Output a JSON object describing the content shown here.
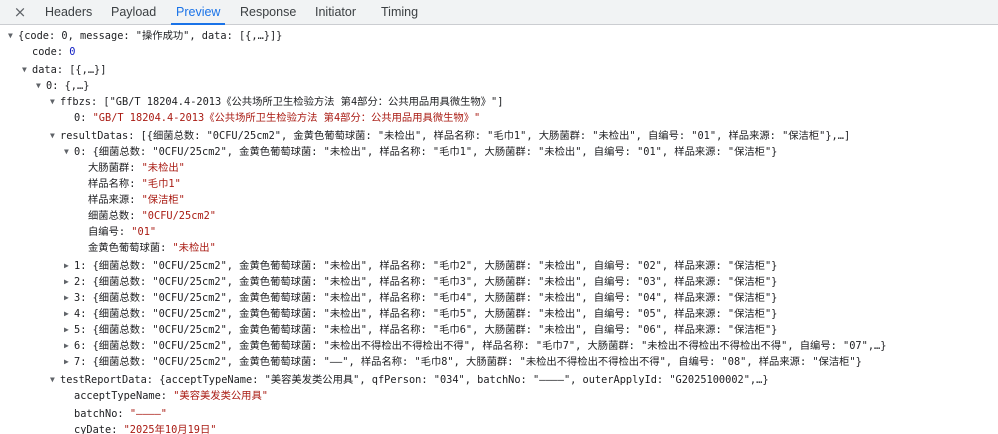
{
  "tabs": [
    {
      "label": "Headers",
      "active": false
    },
    {
      "label": "Payload",
      "active": false
    },
    {
      "label": "Preview",
      "active": true
    },
    {
      "label": "Response",
      "active": false
    },
    {
      "label": "Initiator",
      "active": false
    },
    {
      "label": "Timing",
      "active": false
    }
  ],
  "close_icon": "×",
  "tree": [
    {
      "toggle": "▼",
      "summary": "{code: 0, message: \"操作成功\", data: [{,…}]}"
    },
    {
      "key": "code",
      "value": "0",
      "vtype": "number"
    },
    {
      "toggle": "▼",
      "key": "data",
      "summary": "[{,…}]"
    },
    {
      "toggle": "▼",
      "key": "0",
      "summary": "{,…}"
    },
    {
      "toggle": "▼",
      "key": "ffbzs",
      "summary": "[\"GB/T 18204.4-2013《公共场所卫生检验方法 第4部分：公共用品用具微生物》\"]"
    },
    {
      "key": "0",
      "value": "\"GB/T 18204.4-2013《公共场所卫生检验方法 第4部分：公共用品用具微生物》\"",
      "vtype": "string"
    },
    {
      "toggle": "▼",
      "key": "resultDatas",
      "summary": "[{细菌总数: \"0CFU/25cm2\", 金黄色葡萄球菌: \"未检出\", 样品名称: \"毛巾1\", 大肠菌群: \"未检出\", 自编号: \"01\", 样品来源: \"保洁柜\"},…]"
    },
    {
      "toggle": "▼",
      "key": "0",
      "summary": "{细菌总数: \"0CFU/25cm2\", 金黄色葡萄球菌: \"未检出\", 样品名称: \"毛巾1\", 大肠菌群: \"未检出\", 自编号: \"01\", 样品来源: \"保洁柜\"}"
    },
    {
      "key": "大肠菌群",
      "value": "\"未检出\"",
      "vtype": "string"
    },
    {
      "key": "样品名称",
      "value": "\"毛巾1\"",
      "vtype": "string"
    },
    {
      "key": "样品来源",
      "value": "\"保洁柜\"",
      "vtype": "string"
    },
    {
      "key": "细菌总数",
      "value": "\"0CFU/25cm2\"",
      "vtype": "string"
    },
    {
      "key": "自编号",
      "value": "\"01\"",
      "vtype": "string"
    },
    {
      "key": "金黄色葡萄球菌",
      "value": "\"未检出\"",
      "vtype": "string"
    },
    {
      "toggle": "▶",
      "key": "1",
      "summary": "{细菌总数: \"0CFU/25cm2\", 金黄色葡萄球菌: \"未检出\", 样品名称: \"毛巾2\", 大肠菌群: \"未检出\", 自编号: \"02\", 样品来源: \"保洁柜\"}"
    },
    {
      "toggle": "▶",
      "key": "2",
      "summary": "{细菌总数: \"0CFU/25cm2\", 金黄色葡萄球菌: \"未检出\", 样品名称: \"毛巾3\", 大肠菌群: \"未检出\", 自编号: \"03\", 样品来源: \"保洁柜\"}"
    },
    {
      "toggle": "▶",
      "key": "3",
      "summary": "{细菌总数: \"0CFU/25cm2\", 金黄色葡萄球菌: \"未检出\", 样品名称: \"毛巾4\", 大肠菌群: \"未检出\", 自编号: \"04\", 样品来源: \"保洁柜\"}"
    },
    {
      "toggle": "▶",
      "key": "4",
      "summary": "{细菌总数: \"0CFU/25cm2\", 金黄色葡萄球菌: \"未检出\", 样品名称: \"毛巾5\", 大肠菌群: \"未检出\", 自编号: \"05\", 样品来源: \"保洁柜\"}"
    },
    {
      "toggle": "▶",
      "key": "5",
      "summary": "{细菌总数: \"0CFU/25cm2\", 金黄色葡萄球菌: \"未检出\", 样品名称: \"毛巾6\", 大肠菌群: \"未检出\", 自编号: \"06\", 样品来源: \"保洁柜\"}"
    },
    {
      "toggle": "▶",
      "key": "6",
      "summary": "{细菌总数: \"0CFU/25cm2\", 金黄色葡萄球菌: \"未检出不得检出不得检出不得\", 样品名称: \"毛巾7\", 大肠菌群: \"未检出不得检出不得检出不得\", 自编号: \"07\",…}"
    },
    {
      "toggle": "▶",
      "key": "7",
      "summary": "{细菌总数: \"0CFU/25cm2\", 金黄色葡萄球菌: \"——\", 样品名称: \"毛巾8\", 大肠菌群: \"未检出不得检出不得检出不得\", 自编号: \"08\", 样品来源: \"保洁柜\"}"
    },
    {
      "toggle": "▼",
      "key": "testReportData",
      "summary": "{acceptTypeName: \"美容美发类公用具\", qfPerson: \"034\", batchNo: \"————\", outerApplyId: \"G2025100002\",…}"
    },
    {
      "key": "acceptTypeName",
      "value": "\"美容美发类公用具\"",
      "vtype": "string"
    },
    {
      "key": "batchNo",
      "value": "\"————\"",
      "vtype": "string"
    },
    {
      "key": "cyDate",
      "value": "\"2025年10月19日\"",
      "vtype": "string"
    }
  ]
}
